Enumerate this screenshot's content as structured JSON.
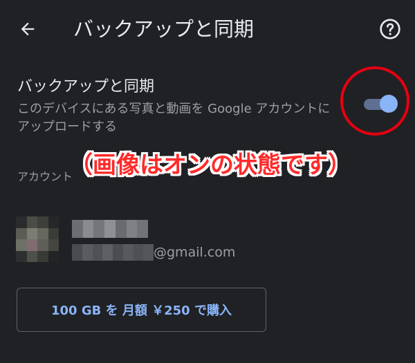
{
  "header": {
    "title": "バックアップと同期",
    "back_icon": "arrow-back-icon",
    "help_icon": "help-circle-icon"
  },
  "backup_setting": {
    "title": "バックアップと同期",
    "description": "このデバイスにある写真と動画を Google アカウントにアップロードする",
    "toggle_on": true
  },
  "annotation": {
    "text": "（画像はオンの状態です）",
    "color": "#ff2a2a"
  },
  "account": {
    "label": "アカウント",
    "email_domain": "@gmail.com"
  },
  "purchase": {
    "label": "100 GB を 月額 ￥250 で購入"
  },
  "colors": {
    "background": "#202124",
    "accent": "#8ab4f8",
    "annotation_red": "#e60012"
  }
}
